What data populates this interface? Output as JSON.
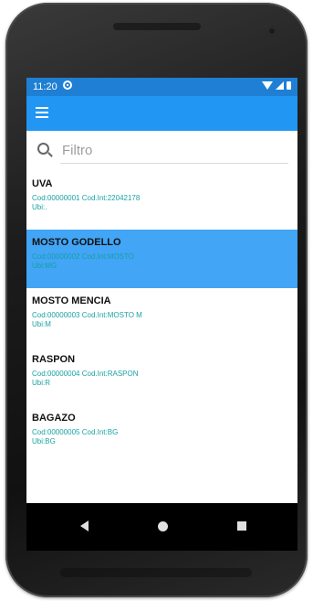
{
  "statusbar": {
    "time": "11:20"
  },
  "search": {
    "placeholder": "Filtro",
    "value": ""
  },
  "items": [
    {
      "name": "UVA",
      "codes": "Cod:00000001 Cod.Int:22042178",
      "ubi": "Ubi:."
    },
    {
      "name": "MOSTO GODELLO",
      "codes": "Cod:00000002 Cod.Int:MOSTO",
      "ubi": "Ubi:MG"
    },
    {
      "name": "MOSTO MENCIA",
      "codes": "Cod:00000003 Cod.Int:MOSTO M",
      "ubi": "Ubi:M"
    },
    {
      "name": "RASPON",
      "codes": "Cod:00000004 Cod.Int:RASPON",
      "ubi": "Ubi:R"
    },
    {
      "name": "BAGAZO",
      "codes": "Cod:00000005 Cod.Int:BG",
      "ubi": "Ubi:BG"
    }
  ],
  "selected_index": 1,
  "colors": {
    "appbar": "#2196f3",
    "statusbar": "#1e7fd4",
    "selected_row": "#42a5f5",
    "detail_text": "#1aa3a3"
  },
  "icons": {
    "menu": "hamburger-menu-icon",
    "search": "search-icon",
    "back": "nav-back-icon",
    "home": "nav-home-icon",
    "recent": "nav-recent-icon"
  }
}
